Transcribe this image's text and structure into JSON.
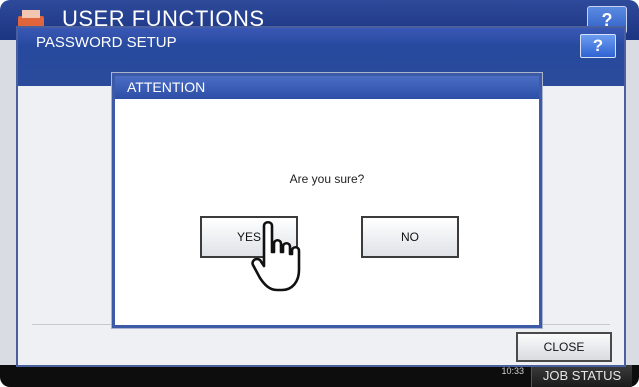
{
  "background_screen": {
    "title": "USER FUNCTIONS",
    "help_label": "?",
    "datetime_top": "",
    "datetime_bottom": "10:33",
    "job_status_label": "JOB STATUS"
  },
  "panel": {
    "title": "PASSWORD SETUP",
    "help_label": "?",
    "close_label": "CLOSE"
  },
  "dialog": {
    "title": "ATTENTION",
    "message": "Are you sure?",
    "yes_label": "YES",
    "no_label": "NO"
  },
  "icons": [
    "printer-logo-icon",
    "pointing-hand-icon"
  ],
  "colors": {
    "title_blue": "#2b4b9a",
    "panel_bg": "#eef0f3",
    "button_border": "#3b3b3b"
  }
}
